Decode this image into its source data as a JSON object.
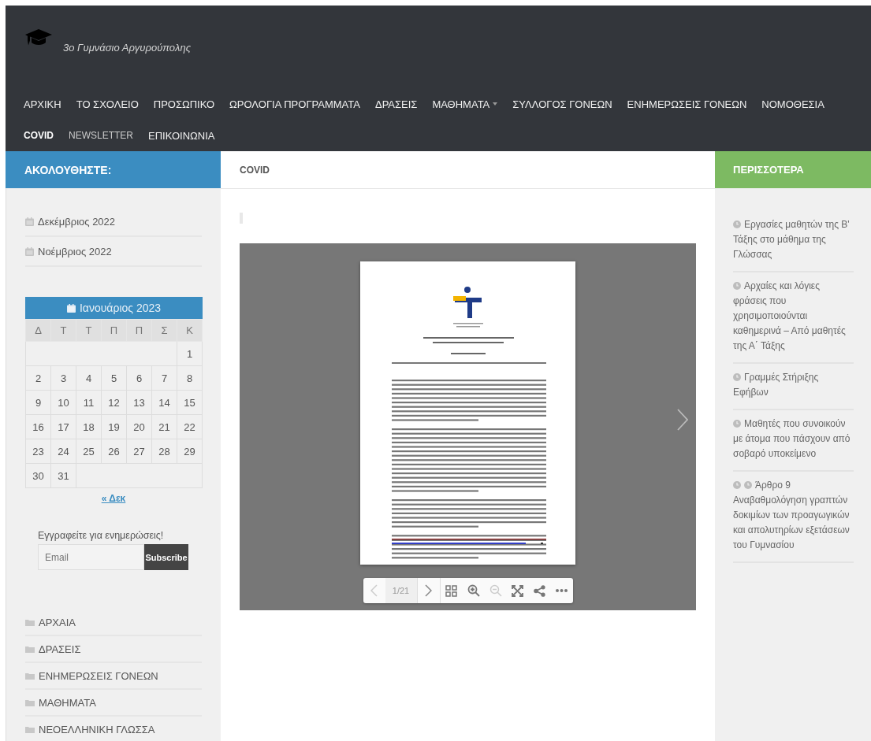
{
  "site": {
    "title": "3ο Γυμνάσιο Αργυρούπολης"
  },
  "nav": [
    {
      "label": "ΑΡΧΙΚΗ",
      "selected": false,
      "has_submenu": false
    },
    {
      "label": "ΤΟ ΣΧΟΛΕΙΟ",
      "selected": false,
      "has_submenu": false
    },
    {
      "label": "ΠΡΟΣΩΠΙΚΟ",
      "selected": false,
      "has_submenu": false
    },
    {
      "label": "ΩΡΟΛΟΓΙΑ ΠΡΟΓΡΑΜΜΑΤΑ",
      "selected": false,
      "has_submenu": false
    },
    {
      "label": "ΔΡΑΣΕΙΣ",
      "selected": false,
      "has_submenu": false
    },
    {
      "label": "ΜΑΘΗΜΑΤΑ",
      "selected": false,
      "has_submenu": true
    },
    {
      "label": "ΣΥΛΛΟΓΟΣ ΓΟΝΕΩΝ",
      "selected": false,
      "has_submenu": false
    },
    {
      "label": "ΕΝΗΜΕΡΩΣΕΙΣ ΓΟΝΕΩΝ",
      "selected": false,
      "has_submenu": false
    },
    {
      "label": "ΝΟΜΟΘΕΣΙΑ",
      "selected": false,
      "has_submenu": false
    },
    {
      "label": "COVID",
      "selected": true,
      "has_submenu": false
    },
    {
      "label": "NEWSLETTER",
      "selected": false,
      "has_submenu": false
    },
    {
      "label": "ΕΠΙΚΟΙΝΩΝΙΑ",
      "selected": false,
      "has_submenu": false
    }
  ],
  "left_sidebar": {
    "heading": "ΑΚΟΛΟΥΘΗΣΤΕ:",
    "archives": [
      "Δεκέμβριος 2022",
      "Νοέμβριος 2022"
    ],
    "calendar": {
      "month": "Ιανουάριος 2023",
      "weekdays": [
        "Δ",
        "Τ",
        "Τ",
        "Π",
        "Π",
        "Σ",
        "Κ"
      ],
      "weeks": [
        {
          "kind": "end",
          "days": [
            "1"
          ]
        },
        {
          "kind": "full",
          "days": [
            "2",
            "3",
            "4",
            "5",
            "6",
            "7",
            "8"
          ]
        },
        {
          "kind": "full",
          "days": [
            "9",
            "10",
            "11",
            "12",
            "13",
            "14",
            "15"
          ]
        },
        {
          "kind": "full",
          "days": [
            "16",
            "17",
            "18",
            "19",
            "20",
            "21",
            "22"
          ]
        },
        {
          "kind": "full",
          "days": [
            "23",
            "24",
            "25",
            "26",
            "27",
            "28",
            "29"
          ]
        },
        {
          "kind": "start",
          "days": [
            "30",
            "31"
          ]
        }
      ],
      "prev_link": "« Δεκ"
    },
    "subscribe": {
      "label": "Εγγραφείτε για ενημερώσεις!",
      "placeholder": "Email",
      "button": "Subscribe"
    },
    "categories": [
      "ΑΡΧΑΙΑ",
      "ΔΡΑΣΕΙΣ",
      "ΕΝΗΜΕΡΩΣΕΙΣ ΓΟΝΕΩΝ",
      "ΜΑΘΗΜΑΤΑ",
      "ΝΕΟΕΛΛΗΝΙΚΗ ΓΛΩΣΣΑ"
    ]
  },
  "main": {
    "heading": "COVID",
    "viewer": {
      "page": "1/21",
      "prev_disabled": true,
      "zoom_out_disabled": true
    }
  },
  "right_sidebar": {
    "heading": "ΠΕΡΙΣΣΟΤΕΡΑ",
    "posts": [
      {
        "title": "Εργασίες μαθητών της Β' Τάξης στο μάθημα της Γλώσσας",
        "kind": "single"
      },
      {
        "title": "Αρχαίες και λόγιες φράσεις που χρησιμοποιούνται καθημερινά – Από μαθητές της Α΄ Τάξης",
        "kind": "single"
      },
      {
        "title": "Γραμμές Στήριξης Εφήβων",
        "kind": "single"
      },
      {
        "title": "Μαθητές που συνοικούν με άτομα που πάσχουν από σοβαρό υποκείμενο",
        "kind": "single"
      },
      {
        "title": "Άρθρο 9 Αναβαθμολόγηση γραπτών δοκιμίων των προαγωγικών και απολυτηρίων εξετάσεων του Γυμνασίου",
        "kind": "double"
      }
    ]
  }
}
